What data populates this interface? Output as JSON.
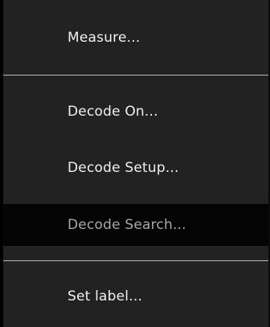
{
  "menu": {
    "items": [
      {
        "label": "Measure..."
      },
      {
        "label": "Decode On..."
      },
      {
        "label": "Decode Setup..."
      },
      {
        "label": "Decode Search...",
        "state": "disabled"
      },
      {
        "label": "Set label..."
      }
    ]
  }
}
